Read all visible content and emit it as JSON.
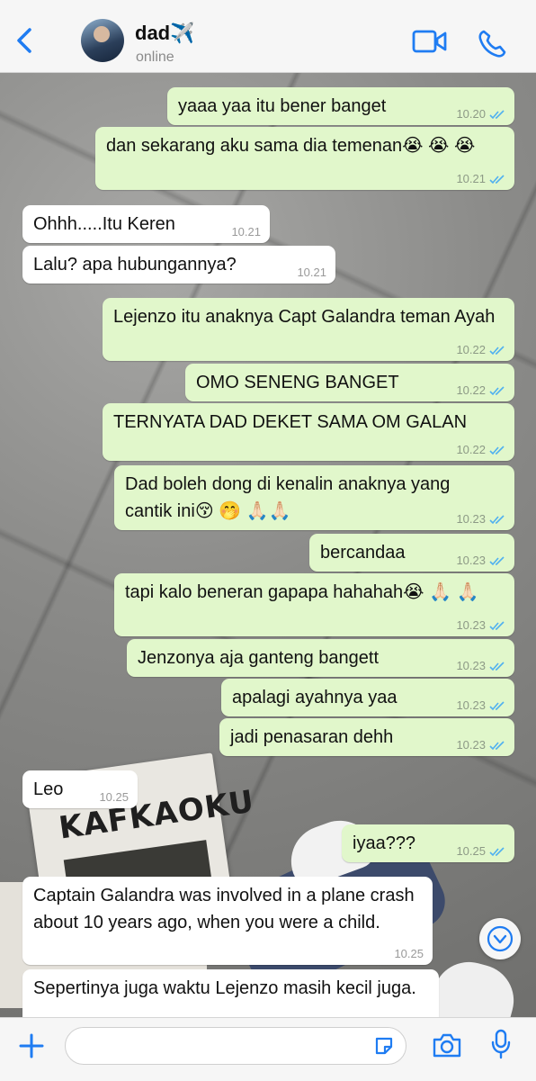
{
  "header": {
    "contact_name": "dad✈️",
    "status": "online"
  },
  "colors": {
    "accent": "#1f7cf2",
    "outgoing_bubble": "#e1f7cb",
    "incoming_bubble": "#ffffff",
    "read_ticks": "#4fb0f0"
  },
  "messages": [
    {
      "dir": "out",
      "text": "yaaa yaa itu bener banget",
      "time": "10.20",
      "read": true
    },
    {
      "dir": "out",
      "text": "dan sekarang aku sama dia temenan😭 😭 😭",
      "time": "10.21",
      "read": true
    },
    {
      "dir": "in",
      "text": "Ohhh.....Itu Keren",
      "time": "10.21"
    },
    {
      "dir": "in",
      "text": "Lalu? apa hubungannya?",
      "time": "10.21"
    },
    {
      "dir": "out",
      "text": "Lejenzo itu anaknya Capt Galandra teman Ayah",
      "time": "10.22",
      "read": true
    },
    {
      "dir": "out",
      "text": "OMO SENENG BANGET",
      "time": "10.22",
      "read": true
    },
    {
      "dir": "out",
      "text": "TERNYATA DAD DEKET SAMA OM GALAN",
      "time": "10.22",
      "read": true
    },
    {
      "dir": "out",
      "text": "Dad boleh dong di kenalin anaknya yang cantik ini😚 🤭 🙏🏻🙏🏻",
      "time": "10.23",
      "read": true
    },
    {
      "dir": "out",
      "text": "bercandaa",
      "time": "10.23",
      "read": true
    },
    {
      "dir": "out",
      "text": "tapi kalo beneran gapapa hahahah😭 🙏🏻 🙏🏻",
      "time": "10.23",
      "read": true
    },
    {
      "dir": "out",
      "text": "Jenzonya aja ganteng bangett",
      "time": "10.23",
      "read": true
    },
    {
      "dir": "out",
      "text": "apalagi ayahnya yaa",
      "time": "10.23",
      "read": true
    },
    {
      "dir": "out",
      "text": "jadi penasaran dehh",
      "time": "10.23",
      "read": true
    },
    {
      "dir": "in",
      "text": "Leo",
      "time": "10.25"
    },
    {
      "dir": "out",
      "text": "iyaa???",
      "time": "10.25",
      "read": true
    },
    {
      "dir": "in",
      "text": "Captain Galandra was involved in a plane crash about 10 years ago, when you were a child.",
      "time": "10.25"
    },
    {
      "dir": "in",
      "text": "Sepertinya juga waktu Lejenzo masih kecil juga.",
      "time": ""
    }
  ],
  "wallpaper": {
    "magazine_title": "KAFKAOKU"
  },
  "icons": {
    "back": "chevron-left-icon",
    "video": "video-camera-icon",
    "call": "phone-icon",
    "attach": "plus-icon",
    "sticker": "sticker-icon",
    "camera": "camera-icon",
    "mic": "microphone-icon",
    "scroll": "chevron-down-icon"
  }
}
